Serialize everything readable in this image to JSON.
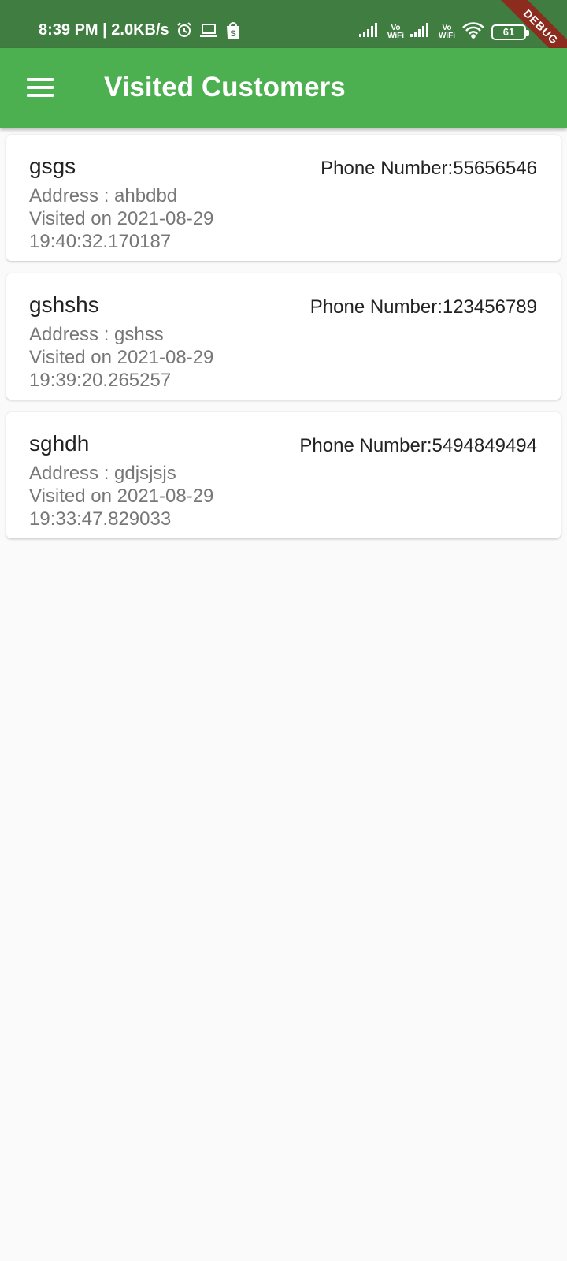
{
  "status_bar": {
    "time_speed": "8:39 PM | 2.0KB/s",
    "vowifi_1_top": "Vo",
    "vowifi_1_bottom": "WiFi",
    "vowifi_2_top": "Vo",
    "vowifi_2_bottom": "WiFi",
    "battery": "61",
    "debug_banner": "DEBUG"
  },
  "app_bar": {
    "title": "Visited Customers",
    "menu_icon": "hamburger-menu-icon"
  },
  "customers": [
    {
      "name": "gsgs",
      "phone": "Phone Number:55656546",
      "address": "Address : ahbdbd",
      "visited": "Visited on 2021-08-29 19:40:32.170187"
    },
    {
      "name": "gshshs",
      "phone": "Phone Number:123456789",
      "address": "Address : gshss",
      "visited": "Visited on 2021-08-29 19:39:20.265257"
    },
    {
      "name": "sghdh",
      "phone": "Phone Number:5494849494",
      "address": "Address : gdjsjsjs",
      "visited": "Visited on 2021-08-29 19:33:47.829033"
    }
  ],
  "colors": {
    "app_bar": "#4caf50",
    "status_bar": "#3f7e40",
    "background": "#fafafa",
    "debug_banner": "#8b2c1e"
  }
}
